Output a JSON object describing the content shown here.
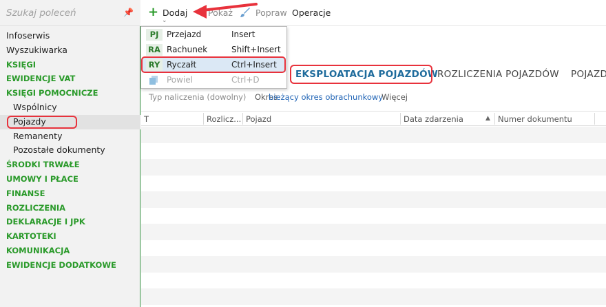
{
  "search": {
    "placeholder": "Szukaj poleceń"
  },
  "sidebar": {
    "items": [
      {
        "label": "Infoserwis",
        "kind": "plain"
      },
      {
        "label": "Wyszukiwarka",
        "kind": "plain"
      },
      {
        "label": "KSIĘGI",
        "kind": "section"
      },
      {
        "label": "EWIDENCJE VAT",
        "kind": "section"
      },
      {
        "label": "KSIĘGI POMOCNICZE",
        "kind": "section"
      },
      {
        "label": "Wspólnicy",
        "kind": "sub"
      },
      {
        "label": "Pojazdy",
        "kind": "sub",
        "selected": true
      },
      {
        "label": "Remanenty",
        "kind": "sub"
      },
      {
        "label": "Pozostałe dokumenty",
        "kind": "sub"
      },
      {
        "label": "ŚRODKI TRWAŁE",
        "kind": "section"
      },
      {
        "label": "UMOWY I PŁACE",
        "kind": "section"
      },
      {
        "label": "FINANSE",
        "kind": "section"
      },
      {
        "label": "ROZLICZENIA",
        "kind": "section"
      },
      {
        "label": "DEKLARACJE I JPK",
        "kind": "section"
      },
      {
        "label": "KARTOTEKI",
        "kind": "section"
      },
      {
        "label": "KOMUNIKACJA",
        "kind": "section"
      },
      {
        "label": "EWIDENCJE DODATKOWE",
        "kind": "section"
      }
    ]
  },
  "toolbar": {
    "add_label": "Dodaj",
    "show_label": "Pokaż",
    "fix_label": "Popraw",
    "ops_label": "Operacje"
  },
  "dropdown": {
    "items": [
      {
        "icon": "PJ",
        "label": "Przejazd",
        "shortcut": "Insert"
      },
      {
        "icon": "RA",
        "label": "Rachunek",
        "shortcut": "Shift+Insert"
      },
      {
        "icon": "RY",
        "label": "Ryczałt",
        "shortcut": "Ctrl+Insert",
        "hover": true
      },
      {
        "icon": "",
        "label": "Powiel",
        "shortcut": "Ctrl+D",
        "disabled": true
      }
    ]
  },
  "tabs": [
    {
      "label": "EKSPLOATACJA POJAZDÓW",
      "active": true
    },
    {
      "label": "ROZLICZENIA POJAZDÓW"
    },
    {
      "label": "POJAZD"
    }
  ],
  "filter": {
    "type_label": "Typ naliczenia (dowolny)",
    "period_prefix": "Okres",
    "period_value": "bieżący okres obrachunkowy",
    "more_label": "Więcej"
  },
  "table": {
    "columns": [
      "T",
      "Rozlicz...",
      "Pojazd",
      "Data zdarzenia",
      "Numer dokumentu"
    ]
  },
  "colors": {
    "accent_green": "#2a9a2a",
    "tab_blue": "#1e6b9c",
    "highlight_red": "#e8323c"
  }
}
